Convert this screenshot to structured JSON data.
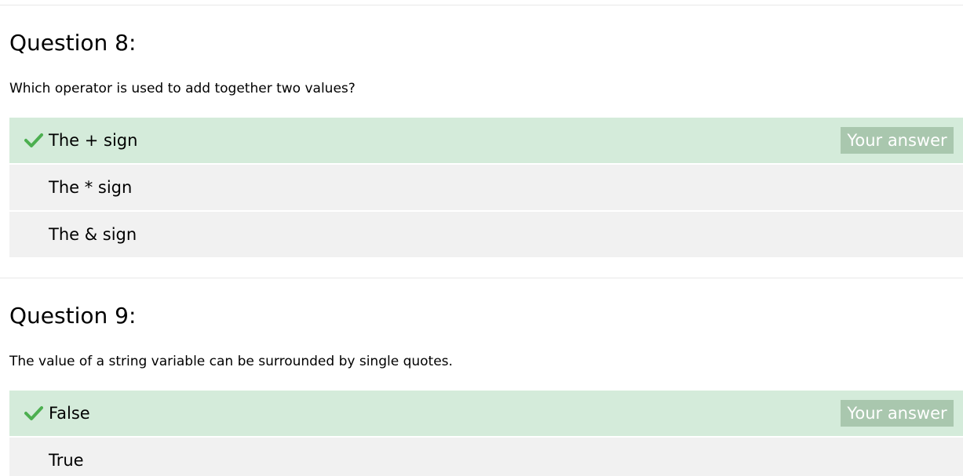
{
  "questions": [
    {
      "title": "Question 8:",
      "text": "Which operator is used to add together two values?",
      "answers": [
        {
          "label": "The + sign",
          "correct": true,
          "badge": "Your answer"
        },
        {
          "label": "The * sign",
          "correct": false
        },
        {
          "label": "The & sign",
          "correct": false
        }
      ]
    },
    {
      "title": "Question 9:",
      "text": "The value of a string variable can be surrounded by single quotes.",
      "answers": [
        {
          "label": "False",
          "correct": true,
          "badge": "Your answer"
        },
        {
          "label": "True",
          "correct": false
        }
      ]
    }
  ],
  "colors": {
    "correct_bg": "#d4ebda",
    "answer_bg": "#f1f1f1",
    "check": "#4caf50",
    "badge_bg": "#a9c7ae",
    "badge_text": "#ffffff"
  },
  "icons": {
    "correct": "checkmark-icon"
  }
}
